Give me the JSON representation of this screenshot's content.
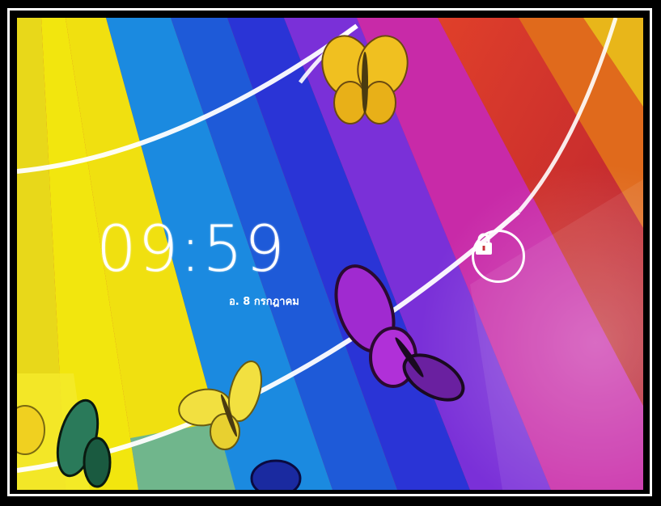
{
  "lockscreen": {
    "time": "09:59",
    "date": "อ. 8 กรกฎาคม"
  },
  "unlock": {
    "icon": "lock-icon"
  },
  "wallpaper": {
    "description_colors": [
      "#f2e40a",
      "#1a7fd8",
      "#2a2fd0",
      "#8a2ad8",
      "#d42a9a",
      "#e03a2a",
      "#e8701a",
      "#e8c01a"
    ]
  }
}
